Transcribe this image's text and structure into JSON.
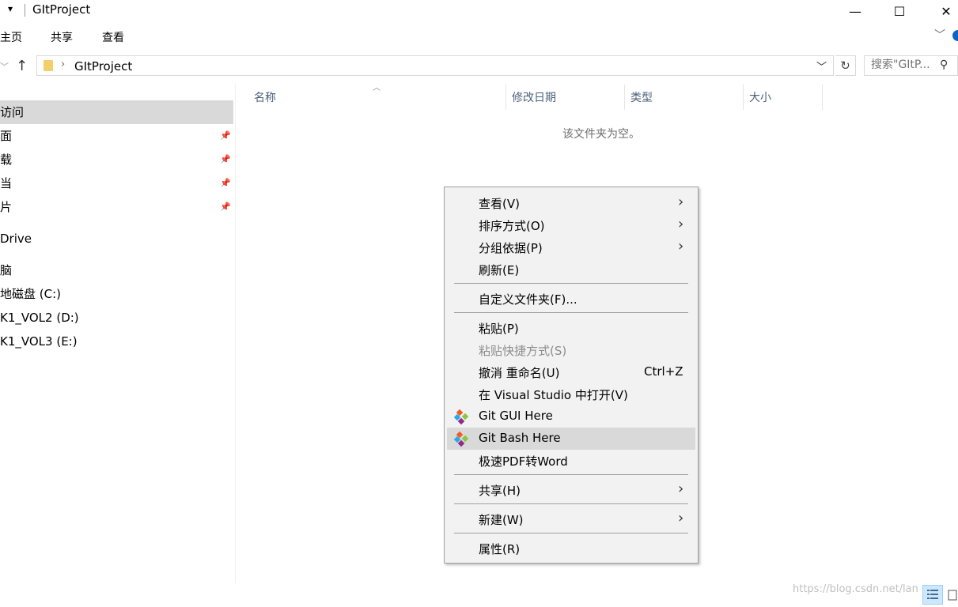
{
  "window": {
    "title": "GItProject",
    "controls": {
      "minimize": "—",
      "maximize": "☐",
      "close": "✕"
    }
  },
  "ribbon": {
    "tabs": [
      "主页",
      "共享",
      "查看"
    ]
  },
  "address": {
    "path": "GItProject",
    "search_placeholder": "搜索\"GItP..."
  },
  "sidebar": {
    "items": [
      {
        "label": "访问",
        "selected": true,
        "pinned": false
      },
      {
        "label": "面",
        "pinned": true
      },
      {
        "label": "载",
        "pinned": true
      },
      {
        "label": "当",
        "pinned": true
      },
      {
        "label": "片",
        "pinned": true
      },
      {
        "label": "Drive"
      },
      {
        "label": "脑"
      },
      {
        "label": "地磁盘 (C:)"
      },
      {
        "label": "K1_VOL2 (D:)"
      },
      {
        "label": "K1_VOL3 (E:)"
      }
    ]
  },
  "filelist": {
    "columns": [
      "名称",
      "修改日期",
      "类型",
      "大小"
    ],
    "empty_message": "该文件夹为空。"
  },
  "context_menu": {
    "items": [
      {
        "label": "查看(V)",
        "submenu": true
      },
      {
        "label": "排序方式(O)",
        "submenu": true
      },
      {
        "label": "分组依据(P)",
        "submenu": true
      },
      {
        "label": "刷新(E)"
      },
      {
        "label": "自定义文件夹(F)..."
      },
      {
        "label": "粘贴(P)"
      },
      {
        "label": "粘贴快捷方式(S)",
        "disabled": true
      },
      {
        "label": "撤消 重命名(U)",
        "shortcut": "Ctrl+Z"
      },
      {
        "label": "在 Visual Studio 中打开(V)"
      },
      {
        "label": "Git GUI Here",
        "icon": "git-icon"
      },
      {
        "label": "Git Bash Here",
        "icon": "git-icon",
        "highlighted": true
      },
      {
        "label": "极速PDF转Word"
      },
      {
        "label": "共享(H)",
        "submenu": true
      },
      {
        "label": "新建(W)",
        "submenu": true
      },
      {
        "label": "属性(R)"
      }
    ]
  },
  "watermark": "https://blog.csdn.net/lan",
  "colors": {
    "selection": "#d9d9d9",
    "menu_bg": "#f2f2f2",
    "folder": "#f2cf6b",
    "column_header": "#4c607a"
  }
}
